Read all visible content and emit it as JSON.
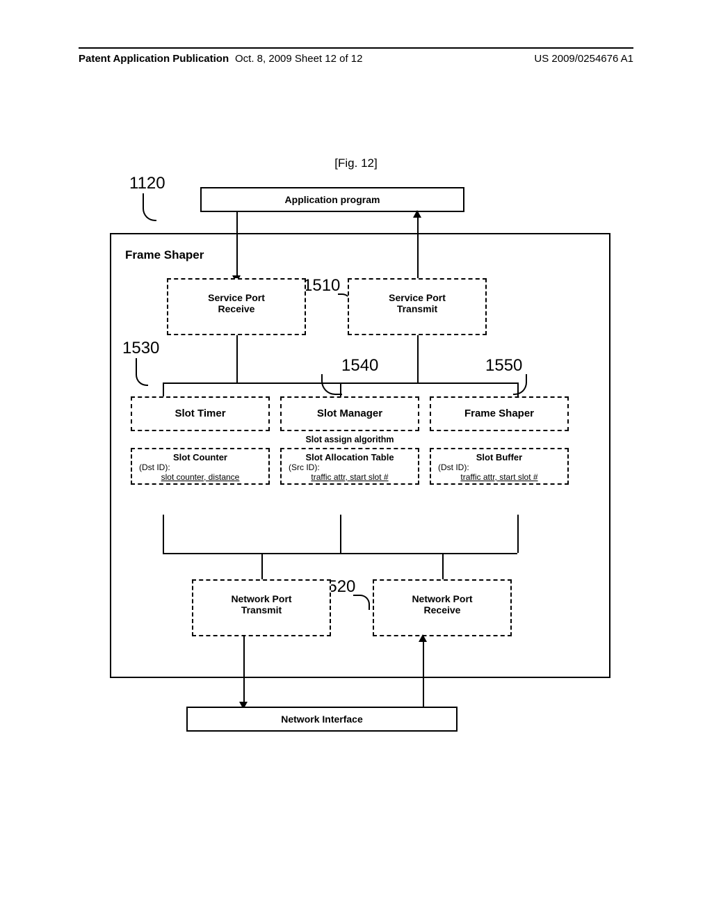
{
  "header": {
    "left": "Patent Application Publication",
    "mid": "Oct. 8, 2009  Sheet 12 of 12",
    "right": "US 2009/0254676 A1"
  },
  "figure": {
    "caption": "[Fig. 12]"
  },
  "refs": {
    "r1120": "1120",
    "r1510": "1510",
    "r1530": "1530",
    "r1540": "1540",
    "r1550": "1550",
    "r1520": "1520"
  },
  "boxes": {
    "app": "Application program",
    "outer": "Frame Shaper",
    "sp_rx_l1": "Service Port",
    "sp_rx_l2": "Receive",
    "sp_tx_l1": "Service Port",
    "sp_tx_l2": "Transmit",
    "np_tx_l1": "Network Port",
    "np_tx_l2": "Transmit",
    "np_rx_l1": "Network Port",
    "np_rx_l2": "Receive",
    "ni": "Network Interface"
  },
  "cols": {
    "slot_timer": {
      "title": "Slot Timer",
      "mid": "",
      "sub_title": "Slot Counter",
      "sub_l1": "(Dst ID):",
      "sub_l2": "slot counter, distance"
    },
    "slot_manager": {
      "title": "Slot Manager",
      "mid": "Slot assign algorithm",
      "sub_title": "Slot Allocation Table",
      "sub_l1": "(Src ID):",
      "sub_l2": "traffic attr, start slot #"
    },
    "frame_shaper": {
      "title": "Frame Shaper",
      "mid": "",
      "sub_title": "Slot Buffer",
      "sub_l1": "(Dst ID):",
      "sub_l2": "traffic attr, start slot #"
    }
  }
}
